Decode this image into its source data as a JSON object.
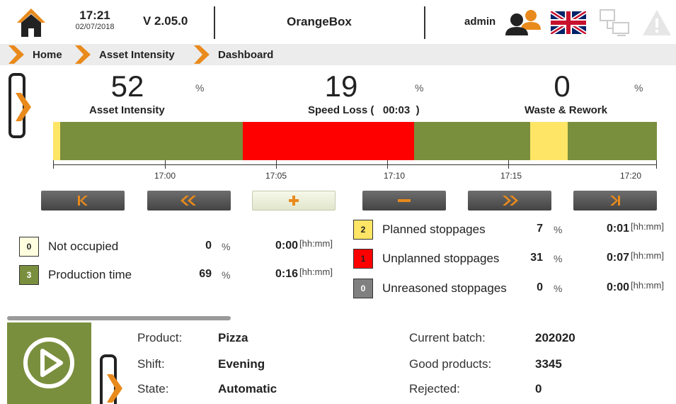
{
  "header": {
    "time": "17:21",
    "date": "02/07/2018",
    "version": "V 2.05.0",
    "app_title": "OrangeBox",
    "user": "admin",
    "icons": {
      "home": "home-icon",
      "users": "users-icon",
      "language": "uk-flag-icon",
      "network": "network-icon",
      "warning": "warning-icon"
    }
  },
  "breadcrumb": [
    "Home",
    "Asset Intensity",
    "Dashboard"
  ],
  "kpis": [
    {
      "value": "52",
      "unit": "%",
      "label": "Asset Intensity"
    },
    {
      "value": "19",
      "unit": "%",
      "label": "Speed Loss (",
      "extra": "00:03",
      "close": ")"
    },
    {
      "value": "0",
      "unit": "%",
      "label": "Waste & Rework"
    }
  ],
  "timeline": {
    "ticks": [
      "17:00",
      "17:05",
      "17:10",
      "17:15",
      "17:20"
    ],
    "colors": {
      "production": "#7a8f3d",
      "unplanned": "#ff0000",
      "planned": "#ffe566"
    }
  },
  "nav_buttons": {
    "first": "K",
    "back": "«",
    "zoom_in": "+",
    "zoom_out": "−",
    "forward": "»",
    "last": "›|"
  },
  "stats_left": [
    {
      "count": "0",
      "label": "Not occupied",
      "percent": "0",
      "unit": "%",
      "duration": "0:00",
      "duration_unit": "[hh:mm]",
      "color": "#ffffe0"
    },
    {
      "count": "3",
      "label": "Production time",
      "percent": "69",
      "unit": "%",
      "duration": "0:16",
      "duration_unit": "[hh:mm]",
      "color": "#7a8f3d"
    }
  ],
  "stats_right": [
    {
      "count": "2",
      "label": "Planned stoppages",
      "percent": "7",
      "unit": "%",
      "duration": "0:01",
      "duration_unit": "[hh:mm]",
      "color": "#ffe566"
    },
    {
      "count": "1",
      "label": "Unplanned stoppages",
      "percent": "31",
      "unit": "%",
      "duration": "0:07",
      "duration_unit": "[hh:mm]",
      "color": "#ff0000"
    },
    {
      "count": "0",
      "label": "Unreasoned stoppages",
      "percent": "0",
      "unit": "%",
      "duration": "0:00",
      "duration_unit": "[hh:mm]",
      "color": "#808080"
    }
  ],
  "info_left": [
    {
      "label": "Product:",
      "value": "Pizza"
    },
    {
      "label": "Shift:",
      "value": "Evening"
    },
    {
      "label": "State:",
      "value": "Automatic"
    }
  ],
  "info_right": [
    {
      "label": "Current batch:",
      "value": "202020"
    },
    {
      "label": "Good products:",
      "value": "3345"
    },
    {
      "label": "Rejected:",
      "value": "0"
    }
  ]
}
